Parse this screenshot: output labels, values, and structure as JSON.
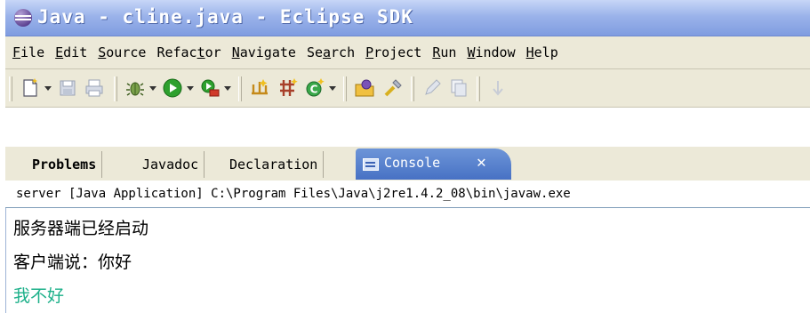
{
  "window": {
    "title": "Java - cline.java - Eclipse SDK"
  },
  "menu": {
    "items": [
      {
        "mnemonic": "F",
        "rest": "ile"
      },
      {
        "mnemonic": "E",
        "rest": "dit"
      },
      {
        "mnemonic": "S",
        "rest": "ource"
      },
      {
        "prefix": "Refac",
        "mnemonic": "t",
        "rest": "or"
      },
      {
        "mnemonic": "N",
        "rest": "avigate"
      },
      {
        "prefix": "Se",
        "mnemonic": "a",
        "rest": "rch"
      },
      {
        "mnemonic": "P",
        "rest": "roject"
      },
      {
        "mnemonic": "R",
        "rest": "un"
      },
      {
        "mnemonic": "W",
        "rest": "indow"
      },
      {
        "mnemonic": "H",
        "rest": "elp"
      }
    ]
  },
  "tabs": {
    "problems": "Problems",
    "javadoc": "Javadoc",
    "declaration": "Declaration",
    "console": "Console",
    "close_glyph": "✕"
  },
  "console": {
    "header": "server [Java Application] C:\\Program Files\\Java\\j2re1.4.2_08\\bin\\javaw.exe",
    "lines": [
      {
        "text": "服务器端已经启动",
        "color": "#000000"
      },
      {
        "text": "客户端说：你好",
        "color": "#000000"
      },
      {
        "text": "我不好",
        "color": "#1db08a"
      }
    ]
  }
}
